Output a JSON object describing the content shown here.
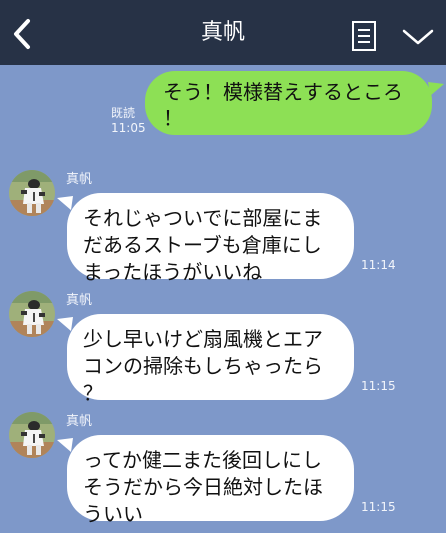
{
  "header": {
    "title": "真帆",
    "back_icon": "chevron-left-icon",
    "notes_icon": "note-icon",
    "menu_icon": "chevron-down-icon",
    "background": "#273246"
  },
  "colors": {
    "chat_background": "#7e98c9",
    "outgoing_bubble": "#8de055",
    "incoming_bubble": "#ffffff"
  },
  "messages": [
    {
      "direction": "outgoing",
      "lines": [
        "そう！模様替えするところ",
        "！"
      ],
      "read_label": "既読",
      "time": "11:05"
    },
    {
      "direction": "incoming",
      "sender": "真帆",
      "lines": [
        "それじゃついでに部屋にま",
        "だあるストーブも倉庫にし",
        "まったほうがいいね"
      ],
      "time": "11:14"
    },
    {
      "direction": "incoming",
      "sender": "真帆",
      "lines": [
        "少し早いけど扇風機とエア",
        "コンの掃除もしちゃったら",
        "？"
      ],
      "time": "11:15"
    },
    {
      "direction": "incoming",
      "sender": "真帆",
      "lines": [
        "ってか健二また後回しにし",
        "そうだから今日絶対したほ",
        "ういい"
      ],
      "time": "11:15"
    }
  ]
}
